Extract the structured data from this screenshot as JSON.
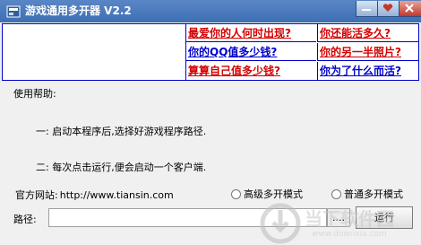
{
  "window": {
    "title": "游戏通用多开器 V2.2"
  },
  "ads": {
    "items": [
      {
        "label": "最爱你的人何时出现?",
        "color": "#d40000"
      },
      {
        "label": "你还能活多久?",
        "color": "#d40000"
      },
      {
        "label": "你的QQ值多少钱?",
        "color": "#0000cc"
      },
      {
        "label": "你的另一半照片?",
        "color": "#d40000"
      },
      {
        "label": "算算自己值多少钱?",
        "color": "#d40000"
      },
      {
        "label": "你为了什么而活?",
        "color": "#0000cc"
      }
    ]
  },
  "help": {
    "title": "使用帮助:",
    "line1": "一: 启动本程序后,选择好游戏程序路径.",
    "line2": "二: 每次点击运行,便会启动一个客户端."
  },
  "website": {
    "label": "官方网站:",
    "url": "http://www.tiansin.com"
  },
  "mode": {
    "advanced": "高级多开模式",
    "normal": "普通多开模式",
    "selected": "normal"
  },
  "path": {
    "label": "路径:",
    "value": "",
    "browse_label": "....",
    "run_label": "运行"
  },
  "watermark": {
    "text": "当下软件园",
    "sub": "www.downxia.com"
  },
  "colors": {
    "titlebar": "#3d6fb4",
    "ad_border": "#0000cc",
    "ad_red": "#d40000",
    "ad_blue": "#0000cc"
  }
}
